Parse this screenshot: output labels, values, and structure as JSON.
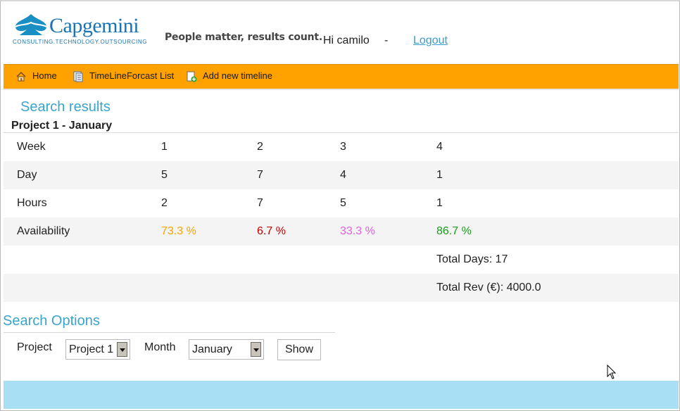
{
  "brand": {
    "logo_text": "Capgemini",
    "logo_subtext": "CONSULTING.TECHNOLOGY.OUTSOURCING",
    "tagline": "People matter, results count."
  },
  "header": {
    "greeting": "Hi camilo",
    "separator": "-",
    "logout_label": "Logout"
  },
  "nav": {
    "items": [
      {
        "label": "Home",
        "icon": "home-icon"
      },
      {
        "label": "TimeLineForcast List",
        "icon": "list-icon"
      },
      {
        "label": "Add new timeline",
        "icon": "add-document-icon"
      }
    ]
  },
  "results": {
    "heading": "Search results",
    "project_title": "Project 1 - January",
    "rows": [
      {
        "label": "Week",
        "cells": [
          "1",
          "2",
          "3",
          "4"
        ]
      },
      {
        "label": "Day",
        "cells": [
          "5",
          "7",
          "4",
          "1"
        ]
      },
      {
        "label": "Hours",
        "cells": [
          "2",
          "7",
          "5",
          "1"
        ]
      },
      {
        "label": "Availability",
        "cells": [
          "73.3 %",
          "6.7 %",
          "33.3 %",
          "86.7 %"
        ]
      }
    ],
    "availability_colors": [
      "#f5a400",
      "#c00000",
      "#e060e0",
      "#1a9c1a"
    ],
    "total_days": "Total Days: 17",
    "total_rev": "Total Rev (€): 4000.0"
  },
  "options": {
    "heading": "Search Options",
    "project_label": "Project",
    "project_value": "Project 1",
    "month_label": "Month",
    "month_value": "January",
    "show_label": "Show"
  },
  "colors": {
    "nav_bg": "#ffa200",
    "heading": "#3aa4cc",
    "footer_bg": "#a9dff4",
    "link": "#3a9ccf"
  }
}
